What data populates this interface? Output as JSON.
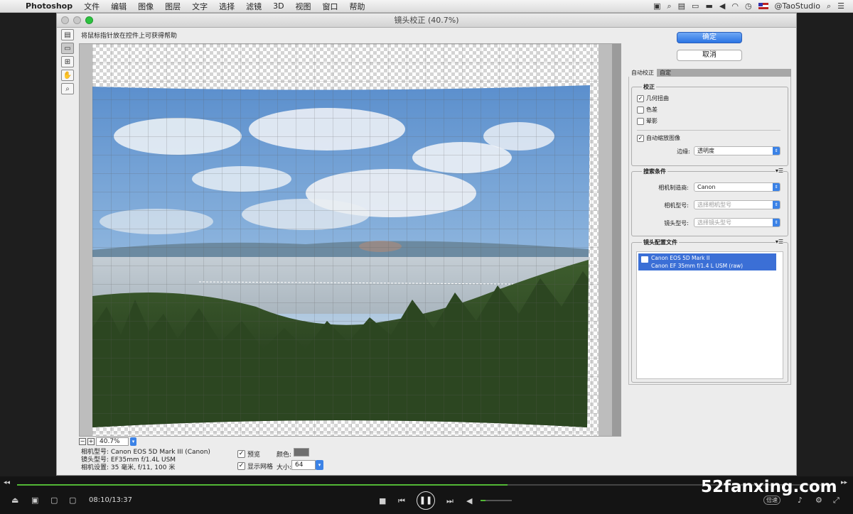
{
  "menubar": {
    "app": "Photoshop",
    "items": [
      "文件",
      "编辑",
      "图像",
      "图层",
      "文字",
      "选择",
      "滤镜",
      "3D",
      "视图",
      "窗口",
      "帮助"
    ],
    "user": "@TaoStudio"
  },
  "dialog": {
    "title": "镜头校正 (40.7%)",
    "hint": "将鼠标指针放在控件上可获得帮助",
    "ok_label": "确定",
    "cancel_label": "取消",
    "zoom": "40.7%"
  },
  "info": {
    "camera": "相机型号: Canon EOS 5D Mark III (Canon)",
    "lens": "镜头型号: EF35mm f/1.4L USM",
    "settings": "相机设置: 35 毫米, f/11, 100 米"
  },
  "options": {
    "preview_label": "预览",
    "preview_checked": true,
    "grid_label": "显示网格",
    "grid_checked": true,
    "color_label": "颜色:",
    "grid_color": "#6e6e6e",
    "size_label": "大小:",
    "size_value": "64"
  },
  "tabs": [
    {
      "label": "自动校正",
      "active": true
    },
    {
      "label": "自定",
      "active": false
    }
  ],
  "correction": {
    "title": "校正",
    "geometric": {
      "label": "几何扭曲",
      "checked": true
    },
    "chromatic": {
      "label": "色差",
      "checked": false
    },
    "vignette": {
      "label": "晕影",
      "checked": false
    },
    "autoscale": {
      "label": "自动缩放图像",
      "checked": true
    },
    "edge_label": "边缘:",
    "edge_value": "透明度"
  },
  "search": {
    "title": "搜索条件",
    "make_label": "相机制造商:",
    "make_value": "Canon",
    "model_label": "相机型号:",
    "model_placeholder": "选择相机型号",
    "lens_label": "镜头型号:",
    "lens_placeholder": "选择镜头型号"
  },
  "profiles": {
    "title": "镜头配置文件",
    "line1": "Canon EOS 5D Mark II",
    "line2": "Canon EF 35mm f/1.4 L USM (raw)"
  },
  "player": {
    "time": "08:10/13:37",
    "progress": 0.6,
    "volume": 0.15,
    "speed_label": "倍速",
    "watermark": "52fanxing.com"
  },
  "colors": {
    "accent": "#3b82e6",
    "progress": "#52b835"
  }
}
